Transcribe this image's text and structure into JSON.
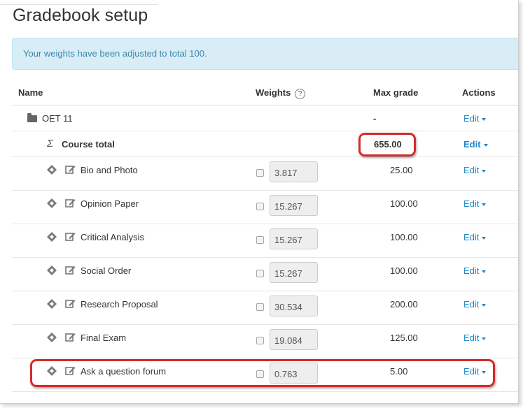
{
  "page": {
    "title": "Gradebook setup",
    "alert": "Your weights have been adjusted to total 100.",
    "alert_close": "×"
  },
  "table": {
    "headers": {
      "name": "Name",
      "weights": "Weights",
      "help": "?",
      "max_grade": "Max grade",
      "actions": "Actions"
    },
    "category": {
      "name": "OET 11",
      "max_grade": "-",
      "action": "Edit"
    },
    "total": {
      "sigma": "Σ",
      "name": "Course total",
      "max_grade": "655.00",
      "action": "Edit"
    },
    "items": [
      {
        "name": "Bio and Photo",
        "weight": "3.817",
        "max_grade": "25.00",
        "action": "Edit"
      },
      {
        "name": "Opinion Paper",
        "weight": "15.267",
        "max_grade": "100.00",
        "action": "Edit"
      },
      {
        "name": "Critical Analysis",
        "weight": "15.267",
        "max_grade": "100.00",
        "action": "Edit"
      },
      {
        "name": "Social Order",
        "weight": "15.267",
        "max_grade": "100.00",
        "action": "Edit"
      },
      {
        "name": "Research Proposal",
        "weight": "30.534",
        "max_grade": "200.00",
        "action": "Edit"
      },
      {
        "name": "Final Exam",
        "weight": "19.084",
        "max_grade": "125.00",
        "action": "Edit"
      },
      {
        "name": "Ask a question forum",
        "weight": "0.763",
        "max_grade": "5.00",
        "action": "Edit"
      }
    ]
  },
  "colors": {
    "link": "#1e88c9",
    "alert_bg": "#d9edf7",
    "alert_text": "#3a87ad",
    "highlight": "#d62a2a"
  },
  "icons": {
    "category": "folder-icon",
    "total": "sigma-icon",
    "move": "move-icon",
    "edit": "edit-icon",
    "help": "help-icon",
    "dropdown": "caret-down-icon"
  }
}
